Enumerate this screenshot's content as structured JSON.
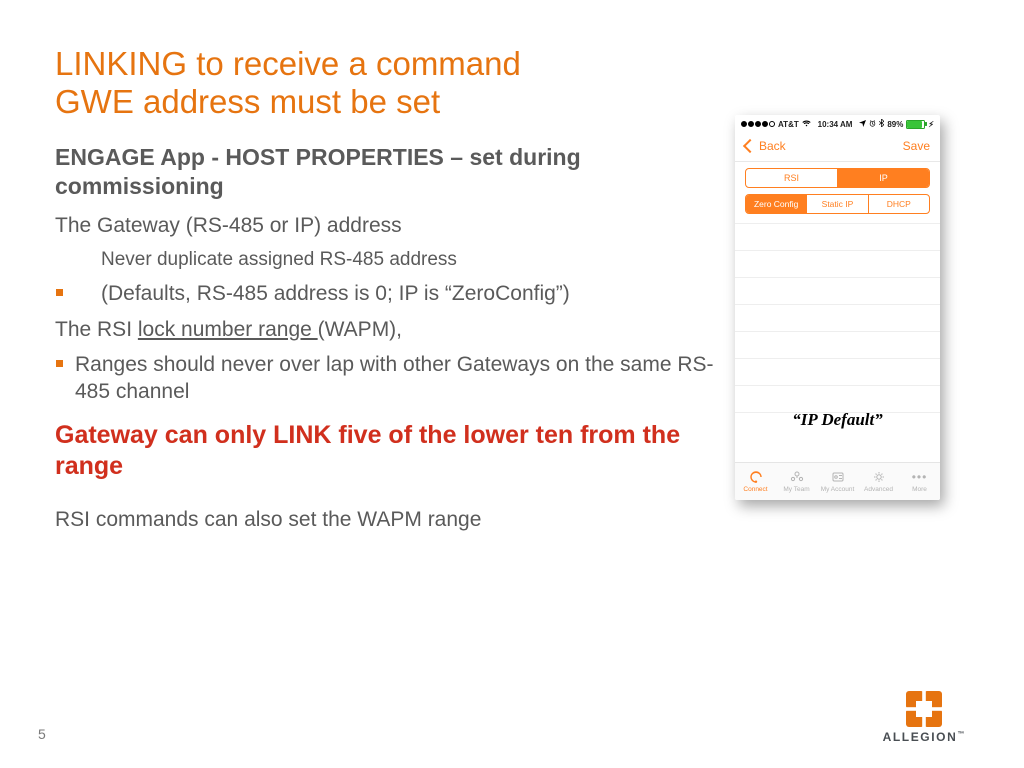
{
  "title_l1": "LINKING to receive a command",
  "title_l2": "GWE address must be set",
  "heading": "ENGAGE App - HOST PROPERTIES – set during commissioning",
  "line_gateway": "The Gateway (RS-485 or IP) address",
  "line_never_dup": "Never duplicate assigned RS-485 address",
  "bullet_defaults": "(Defaults, RS-485 address is 0; IP is “ZeroConfig”)",
  "line_rsi_pre": "The RSI ",
  "line_rsi_under": "lock number range ",
  "line_rsi_post": "(WAPM),",
  "bullet_ranges": "Ranges should never over lap with other Gateways on the same RS-485 channel",
  "red_line": "Gateway can only LINK five of the lower ten from the range",
  "line_rsi_cmd": "RSI commands can also  set the WAPM range",
  "page_num": "5",
  "logo_text": "ALLEGION",
  "phone": {
    "status": {
      "carrier": "AT&T",
      "time": "10:34 AM",
      "battery_pct": "89%"
    },
    "nav": {
      "back": "Back",
      "save": "Save"
    },
    "seg1": {
      "a": "RSI",
      "b": "IP",
      "selected": "b"
    },
    "seg2": {
      "a": "Zero Config",
      "b": "Static IP",
      "c": "DHCP",
      "selected": "a"
    },
    "overlay": "“IP Default”",
    "tabs": {
      "connect": "Connect",
      "team": "My Team",
      "account": "My Account",
      "advanced": "Advanced",
      "more": "More"
    }
  }
}
